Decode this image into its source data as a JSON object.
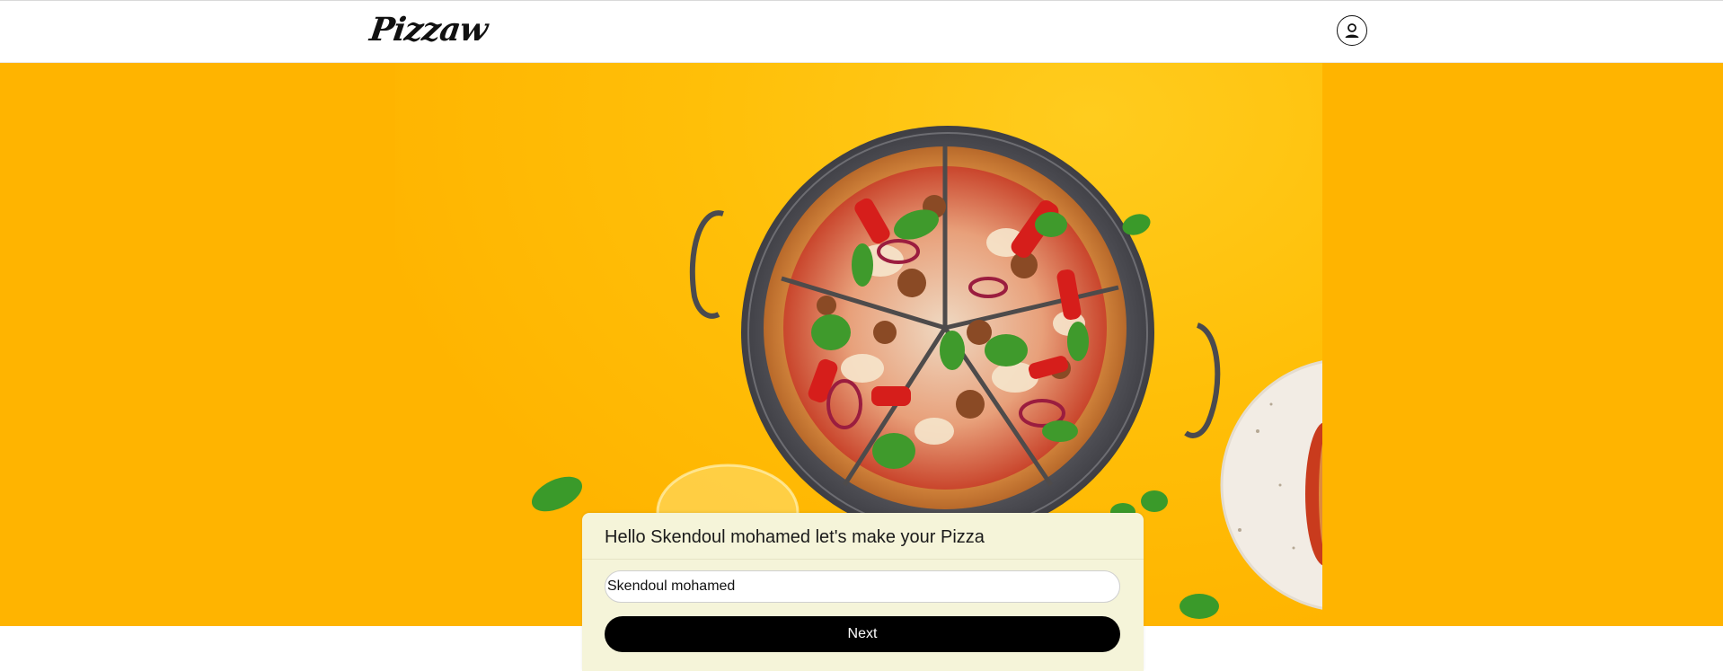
{
  "header": {
    "logo_text": "Pizzaw",
    "account_icon": "user-circle-icon"
  },
  "hero": {
    "image": "pizza-hero-photo"
  },
  "card": {
    "title": "Hello Skendoul mohamed let's make your Pizza",
    "name_input_value": "Skendoul mohamed",
    "next_label": "Next"
  },
  "colors": {
    "hero_background": "#ffb400",
    "card_background": "#f5f4d9",
    "button_background": "#000000",
    "button_text": "#ffffff"
  }
}
